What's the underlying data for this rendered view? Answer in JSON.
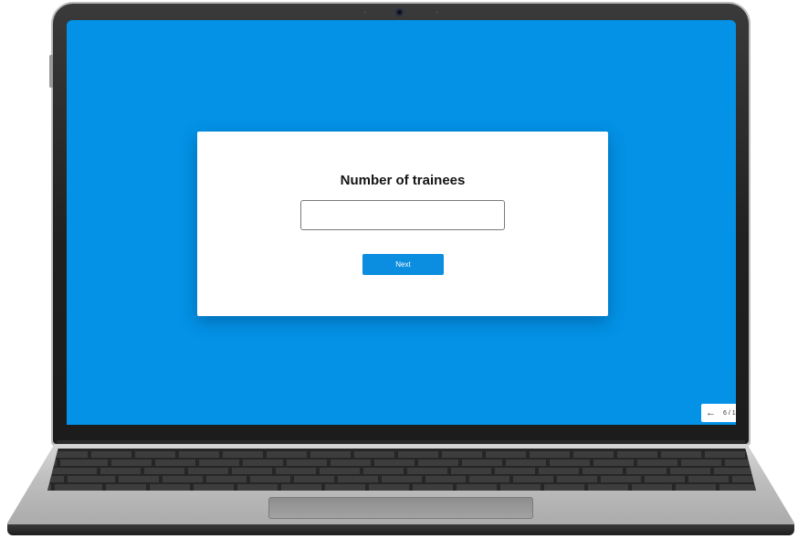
{
  "form": {
    "title": "Number of trainees",
    "input_value": "",
    "input_placeholder": "",
    "next_label": "Next"
  },
  "pager": {
    "back_icon": "arrow-left-icon",
    "counter": "6 / 1"
  },
  "colors": {
    "screen_background": "#0392e6",
    "button": "#0b8de0",
    "card": "#ffffff"
  }
}
